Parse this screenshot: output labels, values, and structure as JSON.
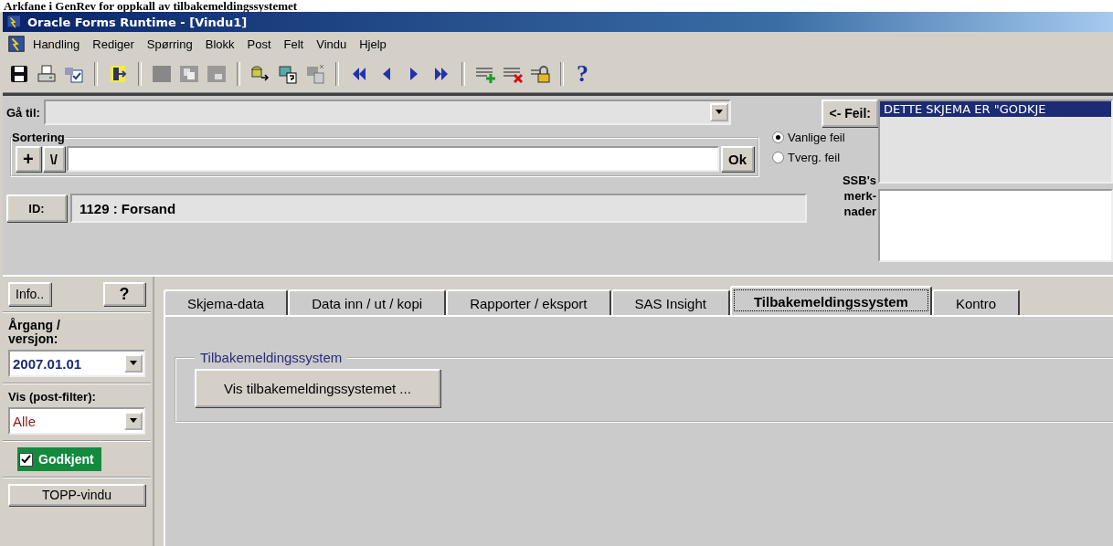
{
  "caption": "Arkfane i GenRev for oppkall av tilbakemeldingssystemet",
  "window": {
    "title": "Oracle Forms Runtime - [Vindu1]"
  },
  "menu": [
    "Handling",
    "Rediger",
    "Spørring",
    "Blokk",
    "Post",
    "Felt",
    "Vindu",
    "Hjelp"
  ],
  "toolbar": {
    "help_label": "?"
  },
  "goto": {
    "label": "Gå til:"
  },
  "sorting": {
    "title": "Sortering",
    "add": "+",
    "sort": "\\/",
    "ok": "Ok"
  },
  "error": {
    "button": "<- Feil:",
    "messages": [
      {
        "text": "DETTE SKJEMA ER \"GODKJE",
        "selected": true
      }
    ],
    "modes": [
      {
        "label": "Vanlige feil",
        "selected": true
      },
      {
        "label": "Tverg. feil",
        "selected": false
      }
    ]
  },
  "remarks": {
    "label": "SSB's\nmerk-\nnader"
  },
  "id": {
    "button": "ID:",
    "value": "1129 : Forsand"
  },
  "sidebar": {
    "info": "Info..",
    "help": "?",
    "year_label": "Årgang /\nversjon:",
    "year": "2007.01.01",
    "filter_label": "Vis (post-filter):",
    "filter": "Alle",
    "approved": {
      "label": "Godkjent",
      "checked": true
    },
    "top_window": "TOPP-vindu"
  },
  "tabs": [
    {
      "label": "Skjema-data",
      "selected": false
    },
    {
      "label": "Data inn / ut / kopi",
      "selected": false
    },
    {
      "label": "Rapporter / eksport",
      "selected": false
    },
    {
      "label": "SAS Insight",
      "selected": false
    },
    {
      "label": "Tilbakemeldingssystem",
      "selected": true
    },
    {
      "label": "Kontro",
      "selected": false
    }
  ],
  "panel": {
    "group_title": "Tilbakemeldingssystem",
    "button": "Vis tilbakemeldingssystemet ..."
  }
}
